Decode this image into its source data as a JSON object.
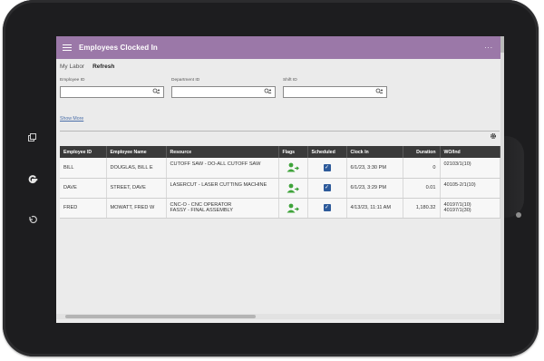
{
  "app": {
    "title": "Employees Clocked In",
    "more_label": "...",
    "accent_color": "#9b78a8"
  },
  "tabs": [
    {
      "label": "My Labor"
    },
    {
      "label": "Refresh"
    }
  ],
  "filters": {
    "employee_id": {
      "label": "Employee ID",
      "value": ""
    },
    "department_id": {
      "label": "Department ID",
      "value": ""
    },
    "shift_id": {
      "label": "Shift ID",
      "value": ""
    },
    "show_more": "Show More",
    "search_icon": "search-people-icon"
  },
  "table": {
    "columns": [
      "Employee ID",
      "Employee Name",
      "Resource",
      "Flags",
      "Scheduled",
      "Clock In",
      "Duration",
      "WO/Ind"
    ],
    "rows": [
      {
        "employee_id": "BILL",
        "employee_name": "DOUGLAS, BILL E",
        "resource": [
          "CUTOFF SAW - DO-ALL CUTOFF SAW"
        ],
        "flag_icon": "person-arrow-icon",
        "scheduled": true,
        "clock_in": "6/1/23, 3:30 PM",
        "duration": "0",
        "wo_ind": [
          "02103/1(10)"
        ]
      },
      {
        "employee_id": "DAVE",
        "employee_name": "STREET, DAVE",
        "resource": [
          "LASERCUT - LASER CUTTING MACHINE"
        ],
        "flag_icon": "person-arrow-icon",
        "scheduled": true,
        "clock_in": "6/1/23, 3:29 PM",
        "duration": "0.01",
        "wo_ind": [
          "40105-2/1(10)"
        ]
      },
      {
        "employee_id": "FRED",
        "employee_name": "MOWATT, FRED W",
        "resource": [
          "CNC-O - CNC OPERATOR",
          "FASSY - FINAL ASSEMBLY"
        ],
        "flag_icon": "person-arrow-icon",
        "scheduled": true,
        "clock_in": "4/13/23, 11:11 AM",
        "duration": "1,180.32",
        "wo_ind": [
          "40197/1(10)",
          "40197/1(30)"
        ]
      }
    ]
  },
  "device": {
    "side_buttons": [
      "copy-icon",
      "google-icon",
      "undo-icon"
    ]
  }
}
